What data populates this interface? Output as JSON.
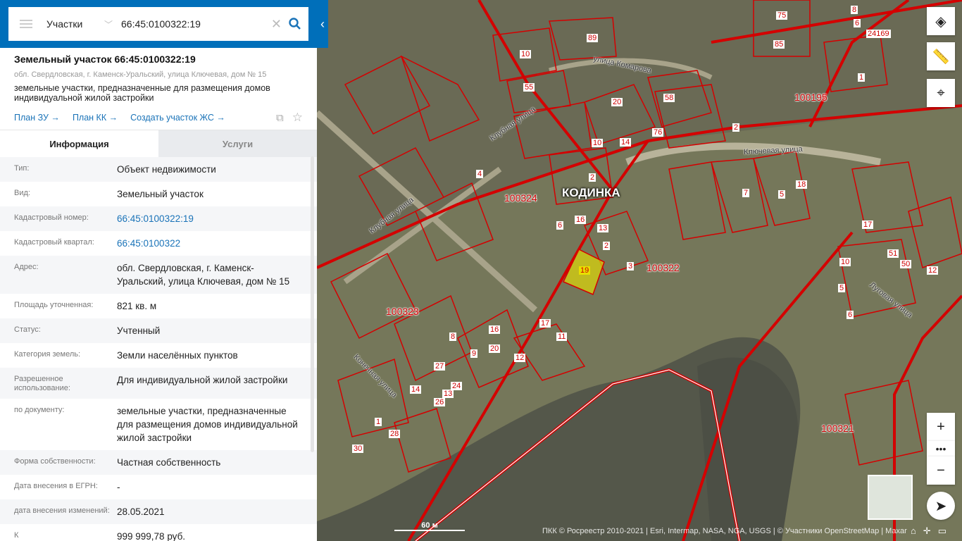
{
  "search": {
    "category": "Участки",
    "query": "66:45:0100322:19"
  },
  "object": {
    "title": "Земельный участок 66:45:0100322:19",
    "address": "обл. Свердловская, г. Каменск-Уральский, улица Ключевая, дом № 15",
    "description": "земельные участки, предназначенные для размещения домов индивидуальной жилой застройки",
    "links": [
      "План ЗУ →",
      "План КК →",
      "Создать участок ЖС →"
    ]
  },
  "tabs": [
    "Информация",
    "Услуги"
  ],
  "info": [
    {
      "k": "Тип:",
      "v": "Объект недвижимости"
    },
    {
      "k": "Вид:",
      "v": "Земельный участок"
    },
    {
      "k": "Кадастровый номер:",
      "v": "66:45:0100322:19"
    },
    {
      "k": "Кадастровый квартал:",
      "v": "66:45:0100322"
    },
    {
      "k": "Адрес:",
      "v": "обл. Свердловская, г. Каменск-Уральский, улица Ключевая, дом № 15"
    },
    {
      "k": "Площадь уточненная:",
      "v": "821 кв. м"
    },
    {
      "k": "Статус:",
      "v": "Учтенный"
    },
    {
      "k": "Категория земель:",
      "v": "Земли населённых пунктов"
    },
    {
      "k": "Разрешенное использование:",
      "v": "Для индивидуальной жилой застройки"
    },
    {
      "k": "по документу:",
      "v": "земельные участки, предназначенные для размещения домов индивидуальной жилой застройки"
    },
    {
      "k": "Форма собственности:",
      "v": "Частная собственность"
    },
    {
      "k": "Дата внесения в ЕГРН:",
      "v": "-"
    },
    {
      "k": "дата внесения изменений:",
      "v": "28.05.2021"
    },
    {
      "k": "К",
      "v": "999 999,78 руб."
    }
  ],
  "map": {
    "town": "КОДИНКА",
    "quarters": [
      "100324",
      "100322",
      "100323",
      "100195",
      "100321"
    ],
    "streets": [
      "улица Комарова",
      "Клубная улица",
      "Ключевая улица",
      "Клубная улица",
      "Луговая улица",
      "Конечная улица"
    ],
    "parcels": [
      "19",
      "13",
      "2",
      "3",
      "16",
      "6",
      "10",
      "14",
      "76",
      "58",
      "20",
      "89",
      "10",
      "55",
      "2",
      "4",
      "17",
      "11",
      "12",
      "27",
      "14",
      "24",
      "13",
      "26",
      "1",
      "28",
      "30",
      "8",
      "9",
      "16",
      "20",
      "5",
      "7",
      "18",
      "5",
      "6",
      "10",
      "17",
      "51",
      "50",
      "12",
      "24169",
      "75",
      "85",
      "8",
      "6",
      "2",
      "1"
    ],
    "scale": "60 м",
    "attribution": "ПКК © Росреестр 2010-2021 | Esri, Intermap, NASA, NGA, USGS | © Участники OpenStreetMap | Maxar"
  },
  "colors": {
    "brand": "#006fba",
    "parcel": "#d40000",
    "selected": "#e8e000"
  }
}
